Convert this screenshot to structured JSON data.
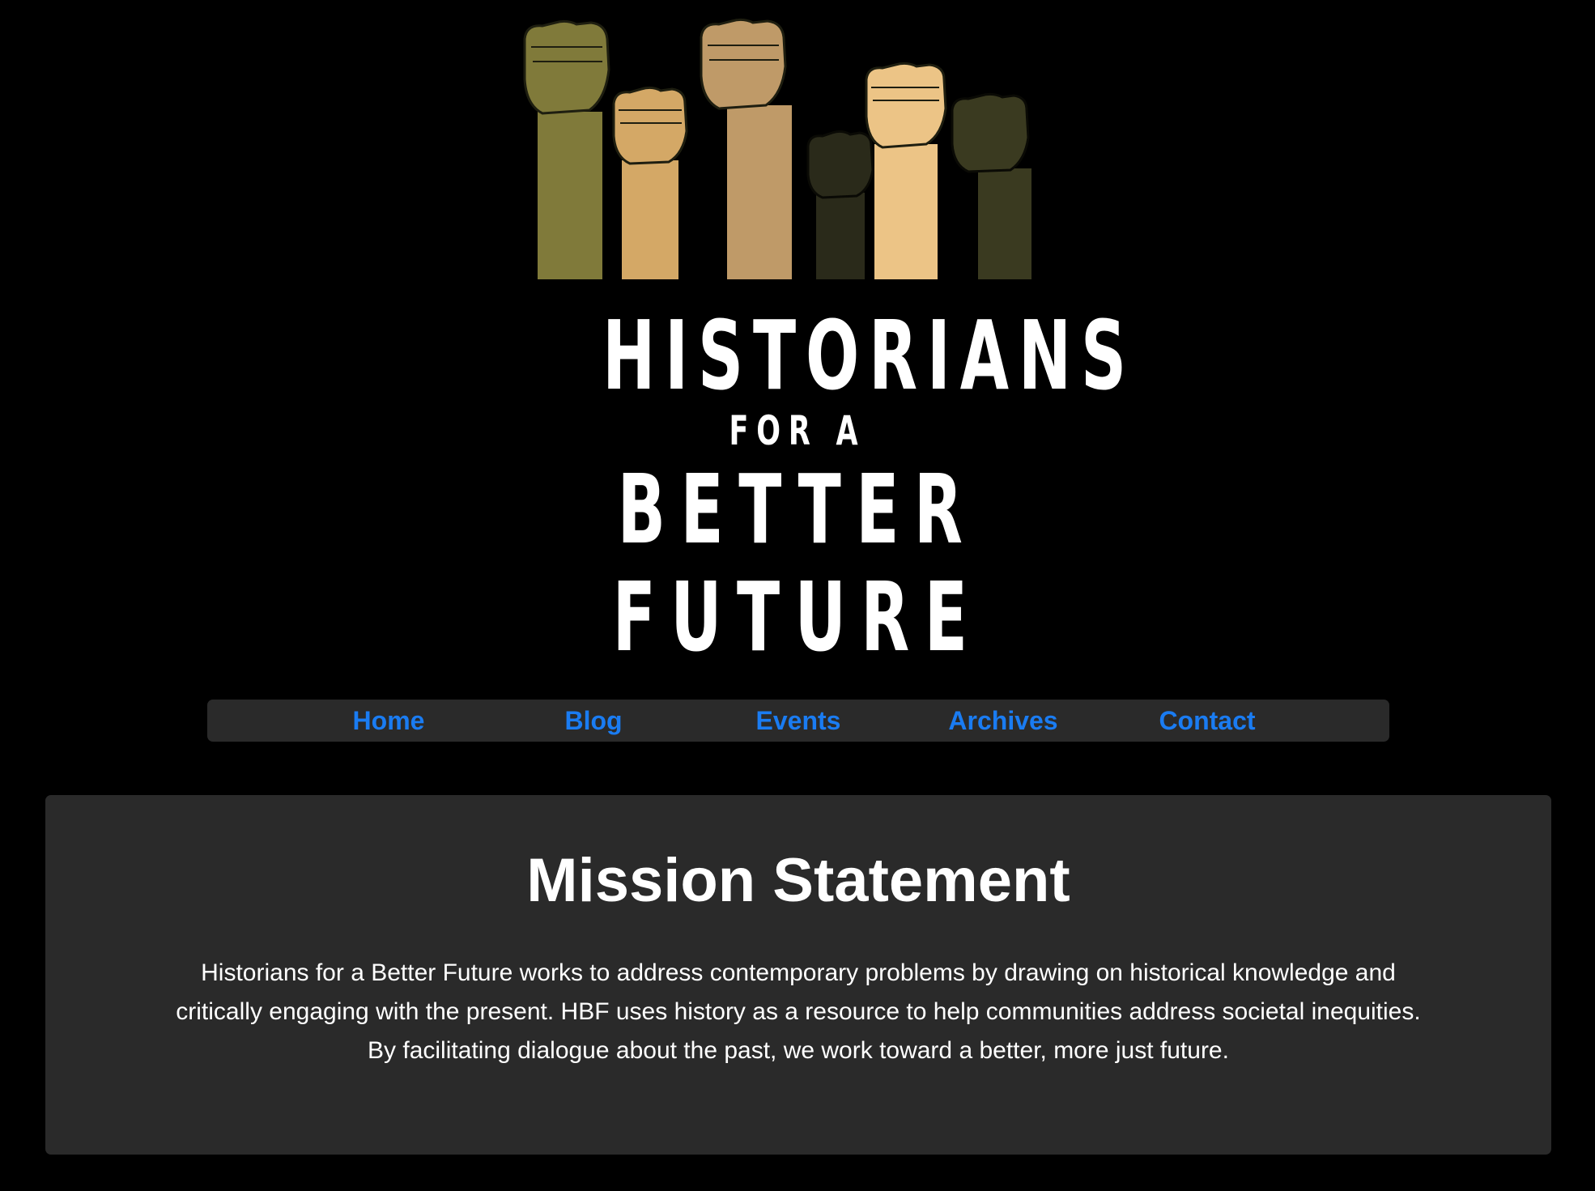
{
  "logo": {
    "line1": "HISTORIANS",
    "line2": "FOR A",
    "line3": "BETTER",
    "line4": "FUTURE",
    "fist_colors": [
      "#807a3a",
      "#d4a866",
      "#bf9a68",
      "#2a2a1a",
      "#ecc486",
      "#3a3a20"
    ]
  },
  "nav": {
    "items": [
      {
        "label": "Home"
      },
      {
        "label": "Blog"
      },
      {
        "label": "Events"
      },
      {
        "label": "Archives"
      },
      {
        "label": "Contact"
      }
    ]
  },
  "mission": {
    "title": "Mission Statement",
    "lines": [
      "Historians for a Better Future works to address contemporary problems by drawing on historical knowledge and",
      "critically engaging with the present. HBF uses history as a resource to help communities address societal inequities.",
      "By facilitating dialogue about the past, we work toward a better, more just future."
    ]
  },
  "colors": {
    "background": "#000000",
    "panel": "#2a2a2a",
    "link": "#1a7cf2",
    "text": "#ffffff"
  }
}
